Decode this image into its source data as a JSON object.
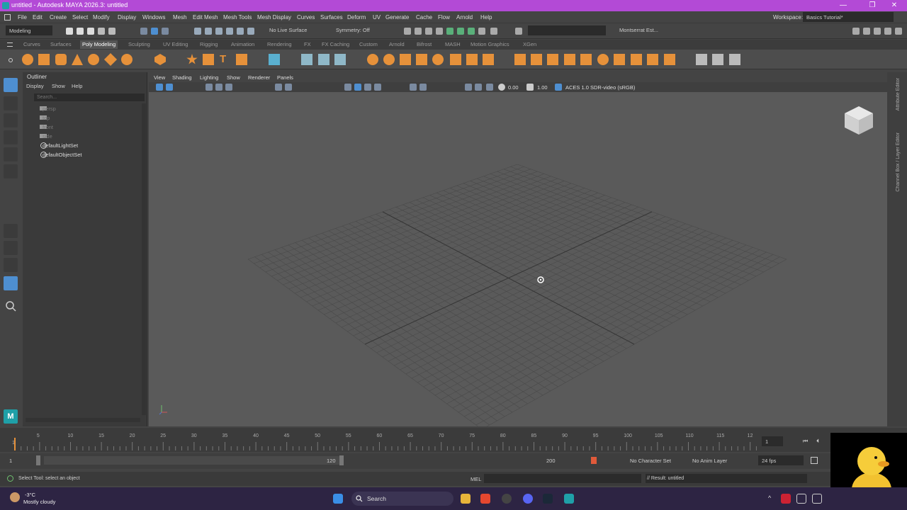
{
  "title_bar": {
    "title": "untitled - Autodesk MAYA 2026.3: untitled",
    "minimize": "—",
    "maximize": "❐",
    "close": "✕"
  },
  "menu": [
    "File",
    "Edit",
    "Create",
    "Select",
    "Modify",
    "Display",
    "Windows",
    "Mesh",
    "Edit Mesh",
    "Mesh Tools",
    "Mesh Display",
    "Curves",
    "Surfaces",
    "Deform",
    "UV",
    "Generate",
    "Cache",
    "Flow",
    "Arnold",
    "Help"
  ],
  "workspace": {
    "label": "Workspace:",
    "value": "Basics Tutorial*"
  },
  "status_line": {
    "mode": "Modeling",
    "live_surface": "No Live Surface",
    "symmetry": "Symmetry: Off",
    "user": "Montserrat Est..."
  },
  "shelf_tabs": [
    "Curves",
    "Surfaces",
    "Poly Modeling",
    "Sculpting",
    "UV Editing",
    "Rigging",
    "Animation",
    "Rendering",
    "FX",
    "FX Caching",
    "Custom",
    "Arnold",
    "Bifrost",
    "MASH",
    "Motion Graphics",
    "XGen"
  ],
  "shelf_tabs_active": "Poly Modeling",
  "outliner": {
    "title": "Outliner",
    "menu": [
      "Display",
      "Show",
      "Help"
    ],
    "search_placeholder": "Search...",
    "items": [
      "persp",
      "top",
      "front",
      "side",
      "defaultLightSet",
      "defaultObjectSet"
    ]
  },
  "viewport": {
    "menu": [
      "View",
      "Shading",
      "Lighting",
      "Show",
      "Renderer",
      "Panels"
    ],
    "exposure": "0.00",
    "gamma": "1.00",
    "color_space": "ACES 1.0 SDR-video (sRGB)"
  },
  "side_strip": [
    "Attribute Editor",
    "Channel Box / Layer Editor"
  ],
  "timeline": {
    "ticks": [
      "1",
      "5",
      "10",
      "15",
      "20",
      "25",
      "30",
      "35",
      "40",
      "45",
      "50",
      "55",
      "60",
      "65",
      "70",
      "75",
      "80",
      "85",
      "90",
      "95",
      "100",
      "105",
      "110",
      "115",
      "12"
    ],
    "current_frame": "1"
  },
  "range": {
    "start": "1",
    "inner_start": "1",
    "inner_end": "120",
    "end": "200",
    "character_set": "No Character Set",
    "anim_layer": "No Anim Layer",
    "fps": "24 fps"
  },
  "command_line": {
    "help": "Select Tool: select an object",
    "lang": "MEL",
    "result": "// Result: untitled"
  },
  "taskbar": {
    "weather_temp": "-3°C",
    "weather_desc": "Mostly cloudy",
    "search": "Search"
  },
  "colors": {
    "titlebar": "#b34ad6",
    "taskbar": "#2d2443",
    "accent_orange": "#e6913a",
    "select_blue": "#4e8fd1"
  }
}
